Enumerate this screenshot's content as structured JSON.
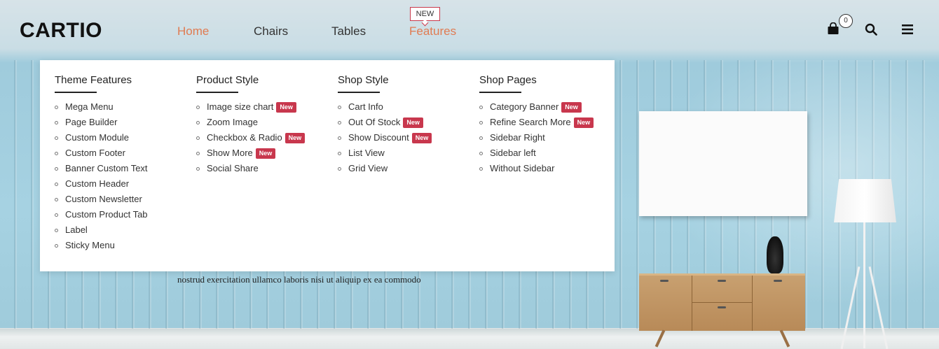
{
  "brand": {
    "logo": "CARTIO"
  },
  "nav": {
    "items": [
      {
        "label": "Home",
        "active": true
      },
      {
        "label": "Chairs",
        "active": false
      },
      {
        "label": "Tables",
        "active": false
      },
      {
        "label": "Features",
        "active": false,
        "badge": "NEW"
      }
    ]
  },
  "header_icons": {
    "cart": {
      "icon": "shopping-bag-icon",
      "count": "0"
    },
    "search": {
      "icon": "search-icon"
    },
    "menu": {
      "icon": "hamburger-menu-icon"
    }
  },
  "mega_menu": {
    "new_tag": "New",
    "columns": [
      {
        "title": "Theme Features",
        "items": [
          {
            "label": "Mega Menu",
            "new": false
          },
          {
            "label": "Page Builder",
            "new": false
          },
          {
            "label": "Custom Module",
            "new": false
          },
          {
            "label": "Custom Footer",
            "new": false
          },
          {
            "label": "Banner Custom Text",
            "new": false
          },
          {
            "label": "Custom Header",
            "new": false
          },
          {
            "label": "Custom Newsletter",
            "new": false
          },
          {
            "label": "Custom Product Tab",
            "new": false
          },
          {
            "label": "Label",
            "new": false
          },
          {
            "label": "Sticky Menu",
            "new": false
          }
        ]
      },
      {
        "title": "Product Style",
        "items": [
          {
            "label": "Image size chart",
            "new": true
          },
          {
            "label": "Zoom Image",
            "new": false
          },
          {
            "label": "Checkbox & Radio",
            "new": true
          },
          {
            "label": "Show More",
            "new": true
          },
          {
            "label": "Social Share",
            "new": false
          }
        ]
      },
      {
        "title": "Shop Style",
        "items": [
          {
            "label": "Cart Info",
            "new": false
          },
          {
            "label": "Out Of Stock",
            "new": true
          },
          {
            "label": "Show Discount",
            "new": true
          },
          {
            "label": "List View",
            "new": false
          },
          {
            "label": "Grid View",
            "new": false
          }
        ]
      },
      {
        "title": "Shop Pages",
        "items": [
          {
            "label": "Category Banner",
            "new": true
          },
          {
            "label": "Refine Search More",
            "new": true
          },
          {
            "label": "Sidebar Right",
            "new": false
          },
          {
            "label": "Sidebar left",
            "new": false
          },
          {
            "label": "Without Sidebar",
            "new": false
          }
        ]
      }
    ]
  },
  "hero": {
    "text": "nostrud exercitation ullamco laboris nisi ut aliquip ex ea commodo"
  },
  "colors": {
    "accent": "#e07b52",
    "badge": "#c8374d",
    "text": "#333333"
  }
}
